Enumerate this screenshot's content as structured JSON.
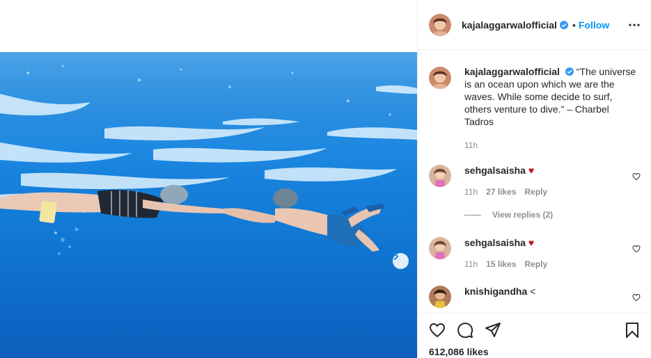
{
  "post": {
    "username": "kajalaggarwalofficial",
    "dot": "•",
    "follow_label": "Follow",
    "caption": "“The universe is an ocean upon which we are the waves. While some decide to surf, others venture to dive.” – Charbel Tadros",
    "caption_time": "11h",
    "likes": "612,086 likes"
  },
  "comments": [
    {
      "username": "sehgalsaisha",
      "emoji": "♥",
      "time": "11h",
      "likes": "27 likes",
      "reply_label": "Reply",
      "view_replies": "View replies (2)"
    },
    {
      "username": "sehgalsaisha",
      "emoji": "♥",
      "time": "11h",
      "likes": "15 likes",
      "reply_label": "Reply"
    },
    {
      "username": "knishigandha",
      "text": "<"
    }
  ],
  "colors": {
    "accent": "#0095f6",
    "verified": "#3897f0",
    "heart": "#c0121c",
    "text": "#262626",
    "muted": "#8e8e8e"
  },
  "icons": [
    "verified-badge-icon",
    "more-options-icon",
    "like-icon",
    "comment-icon",
    "share-icon",
    "save-icon",
    "chevron-right-icon",
    "comment-like-icon"
  ]
}
